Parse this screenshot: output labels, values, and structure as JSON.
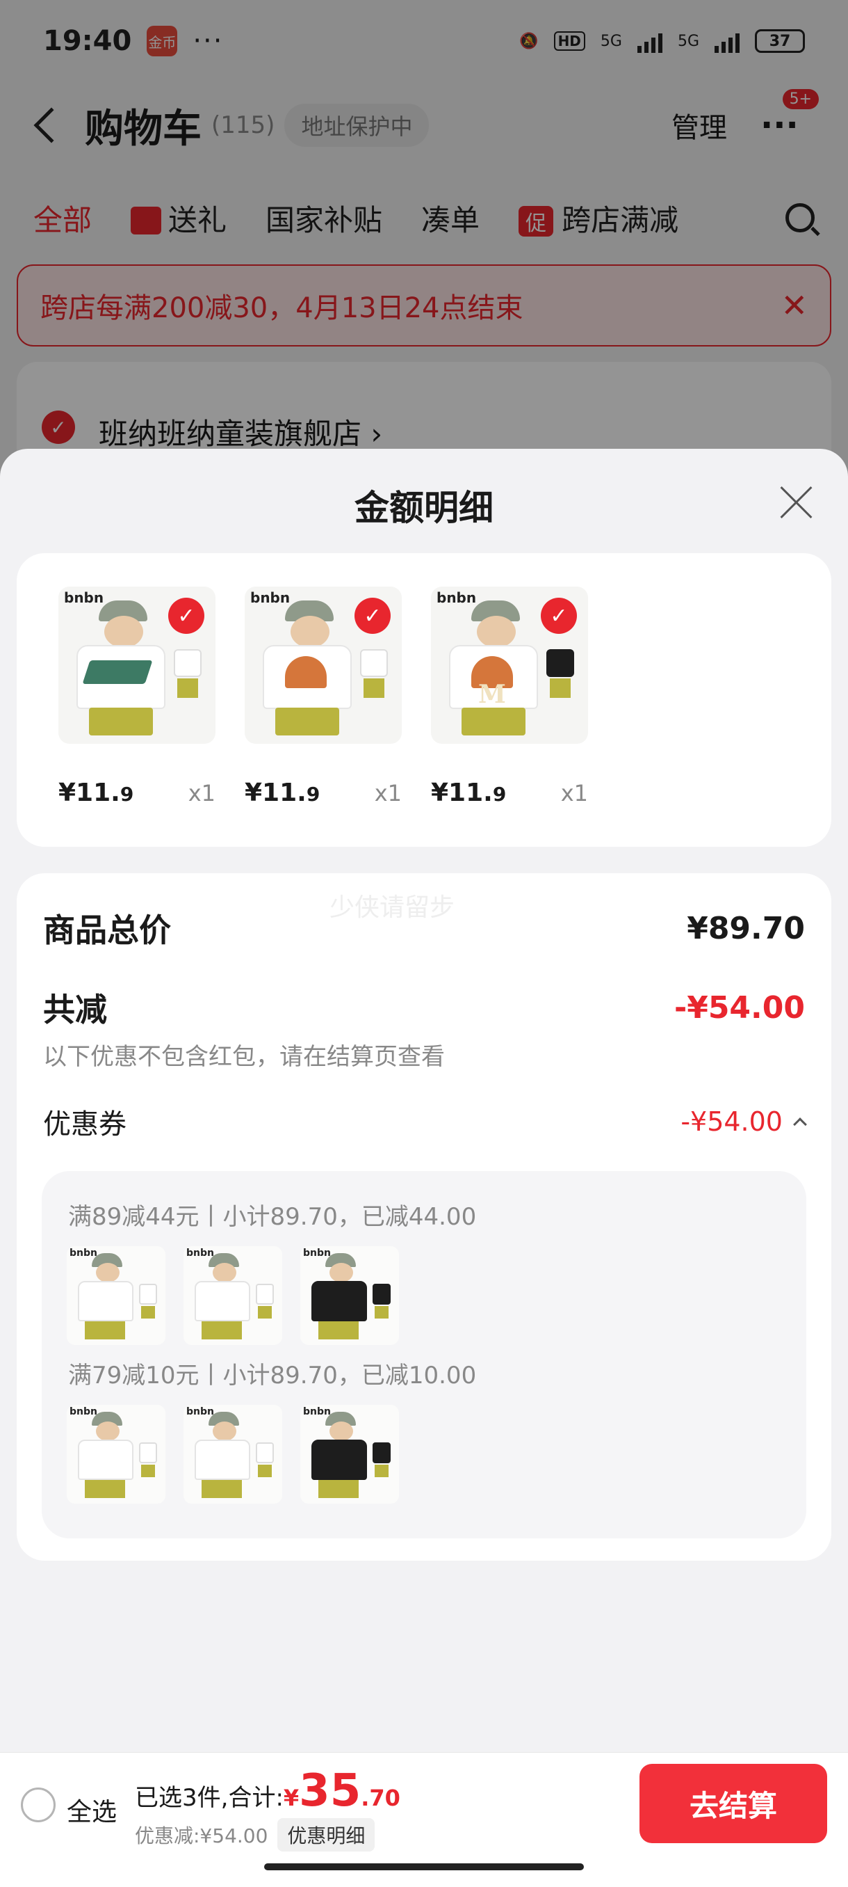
{
  "status_bar": {
    "time": "19:40",
    "app_badge": "金币",
    "dots": "···",
    "hd": "HD",
    "net1": "5G",
    "net2": "5G",
    "battery": "37",
    "icons": [
      "bell-mute-icon",
      "signal-icon",
      "battery-icon"
    ]
  },
  "nav": {
    "title": "购物车",
    "count": "(115)",
    "address_status": "地址保护中",
    "manage": "管理",
    "more_badge": "5+"
  },
  "filter_tabs": [
    {
      "label": "全部",
      "active": true
    },
    {
      "label": "送礼"
    },
    {
      "label": "国家补贴"
    },
    {
      "label": "凑单"
    },
    {
      "label": "跨店满减",
      "tag": "促"
    }
  ],
  "promo_banner": {
    "text": "跨店每满200减30，4月13日24点结束"
  },
  "store": {
    "name": "班纳班纳童装旗舰店 ›"
  },
  "sheet": {
    "title": "金额明细",
    "products": [
      {
        "price_int": "¥11.",
        "price_dec": "9",
        "qty": "x1"
      },
      {
        "price_int": "¥11.",
        "price_dec": "9",
        "qty": "x1"
      },
      {
        "price_int": "¥11.",
        "price_dec": "9",
        "qty": "x1"
      }
    ],
    "thumb_brand": "bnbn",
    "thumb_print_letter": "M",
    "thumb_check": "✓",
    "watermark": "少侠请留步",
    "total_label": "商品总价",
    "total_value": "¥89.70",
    "reduce_label": "共减",
    "reduce_value": "-¥54.00",
    "reduce_note": "以下优惠不包含红包，请在结算页查看",
    "coupon_label": "优惠券",
    "coupon_value": "-¥54.00",
    "coupon_lines": [
      "满89减44元丨小计89.70，已减44.00",
      "满79减10元丨小计89.70，已减10.00"
    ]
  },
  "bottom_bar": {
    "select_all": "全选",
    "sum_label": "已选3件,合计:",
    "sum_yen": "¥",
    "sum_int": "35",
    "sum_dec": ".70",
    "discount": "优惠减:¥54.00",
    "detail_button": "优惠明细",
    "checkout": "去结算"
  },
  "colors": {
    "accent": "#e8262e",
    "checkout": "#f2303a",
    "sheet_bg": "#f2f2f4"
  }
}
